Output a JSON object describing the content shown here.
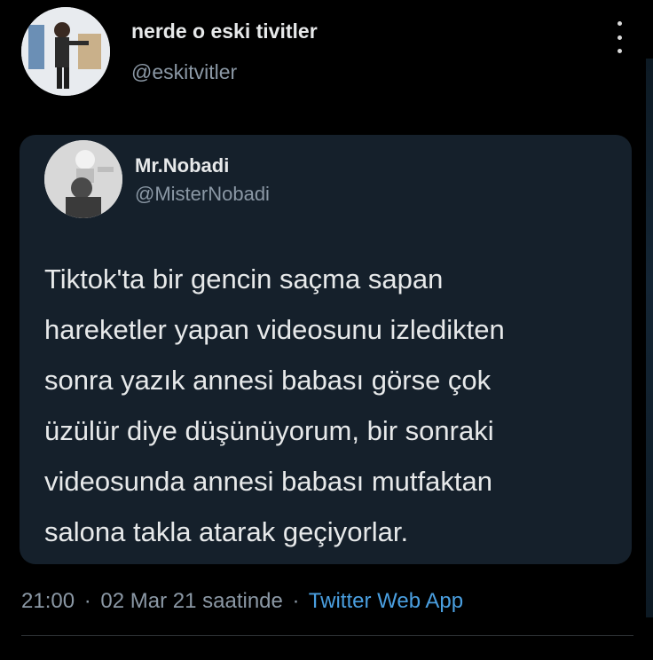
{
  "tweet": {
    "author": {
      "name": "nerde o eski tivitler",
      "handle": "@eskitvitler"
    },
    "quoted": {
      "name": "Mr.Nobadi",
      "handle": "@MisterNobadi",
      "text_lines": [
        "Tiktok'ta bir gencin saçma sapan",
        "hareketler yapan videosunu izledikten",
        "sonra yazık annesi babası görse çok",
        "üzülür diye düşünüyorum, bir sonraki",
        "videosunda annesi babası mutfaktan",
        "salona takla atarak geçiyorlar."
      ]
    },
    "meta": {
      "time": "21:00",
      "date": "02 Mar 21 saatinde",
      "separator": "·",
      "source": "Twitter Web App"
    }
  },
  "colors": {
    "background": "#000000",
    "card": "#15202b",
    "secondary_text": "#8b98a5",
    "link": "#4a9fe0"
  },
  "icons": {
    "menu": "more-vertical-icon"
  }
}
